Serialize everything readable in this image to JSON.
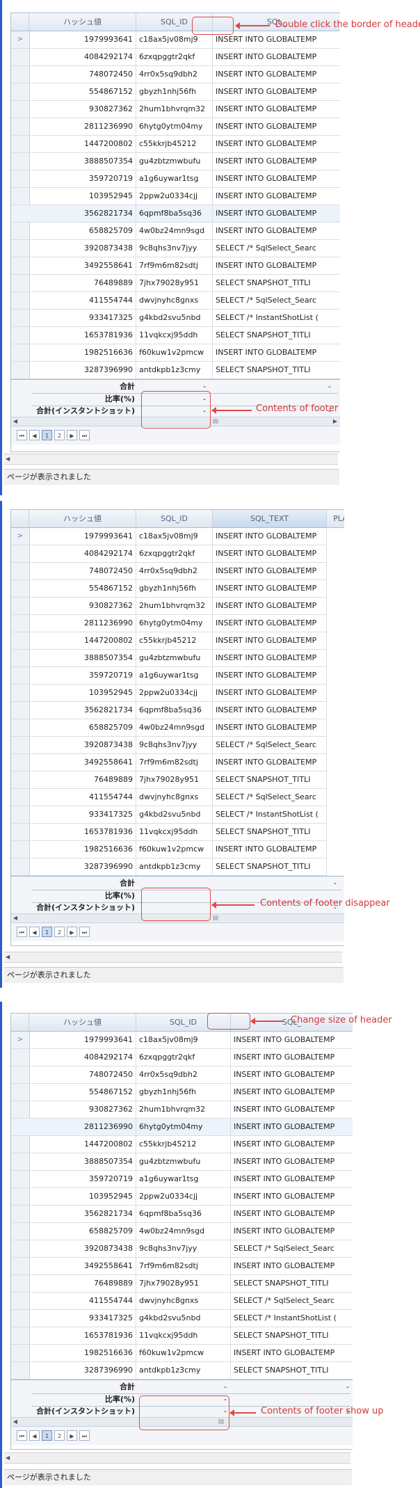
{
  "columns": {
    "hash": "ハッシュ値",
    "sql_id": "SQL_ID",
    "sql_text": "SQL_TEXT",
    "sql_text_clipped": "SQL_",
    "plan_clipped": "PLA"
  },
  "rows": [
    {
      "hash": "1979993641",
      "sql_id": "c18ax5jv08mj9",
      "sql_text": "INSERT INTO GLOBALTEMP"
    },
    {
      "hash": "4084292174",
      "sql_id": "6zxqpggtr2qkf",
      "sql_text": "INSERT INTO GLOBALTEMP"
    },
    {
      "hash": "748072450",
      "sql_id": "4rr0x5sq9dbh2",
      "sql_text": "INSERT INTO GLOBALTEMP"
    },
    {
      "hash": "554867152",
      "sql_id": "gbyzh1nhj56fh",
      "sql_text": "INSERT INTO GLOBALTEMP"
    },
    {
      "hash": "930827362",
      "sql_id": "2hum1bhvrqm32",
      "sql_text": "INSERT INTO GLOBALTEMP"
    },
    {
      "hash": "2811236990",
      "sql_id": "6hytg0ytm04my",
      "sql_text": "INSERT INTO GLOBALTEMP"
    },
    {
      "hash": "1447200802",
      "sql_id": "c55kkrjb45212",
      "sql_text": "INSERT INTO GLOBALTEMP"
    },
    {
      "hash": "3888507354",
      "sql_id": "gu4zbtzmwbufu",
      "sql_text": "INSERT INTO GLOBALTEMP"
    },
    {
      "hash": "359720719",
      "sql_id": "a1g6uywar1tsg",
      "sql_text": "INSERT INTO GLOBALTEMP"
    },
    {
      "hash": "103952945",
      "sql_id": "2ppw2u0334cjj",
      "sql_text": "INSERT INTO GLOBALTEMP"
    },
    {
      "hash": "3562821734",
      "sql_id": "6qpmf8ba5sq36",
      "sql_text": "INSERT INTO GLOBALTEMP"
    },
    {
      "hash": "658825709",
      "sql_id": "4w0bz24mn9sgd",
      "sql_text": "INSERT INTO GLOBALTEMP"
    },
    {
      "hash": "3920873438",
      "sql_id": "9c8qhs3nv7jyy",
      "sql_text": "SELECT /* SqlSelect_Searc"
    },
    {
      "hash": "3492558641",
      "sql_id": "7rf9m6m82sdtj",
      "sql_text": "INSERT INTO GLOBALTEMP"
    },
    {
      "hash": "76489889",
      "sql_id": "7jhx79028y951",
      "sql_text": "  SELECT   SNAPSHOT_TITLI"
    },
    {
      "hash": "411554744",
      "sql_id": "dwvjnyhc8gnxs",
      "sql_text": "SELECT /* SqlSelect_Searc"
    },
    {
      "hash": "933417325",
      "sql_id": "g4kbd2svu5nbd",
      "sql_text": "SELECT /* InstantShotList ("
    },
    {
      "hash": "1653781936",
      "sql_id": "11vqkcxj95ddh",
      "sql_text": "  SELECT   SNAPSHOT_TITLI"
    },
    {
      "hash": "1982516636",
      "sql_id": "f60kuw1v2pmcw",
      "sql_text": "INSERT INTO GLOBALTEMP"
    },
    {
      "hash": "3287396990",
      "sql_id": "antdkpb1z3cmy",
      "sql_text": "  SELECT   SNAPSHOT_TITLI"
    }
  ],
  "footer": {
    "total_label": "合計",
    "ratio_label": "比率(%)",
    "instant_label": "合計(インスタントショット)",
    "value": "-"
  },
  "pager": {
    "page1": "1",
    "page2": "2"
  },
  "status_text": "ページが表示されました",
  "annotations": {
    "a1": "Double click the border of header",
    "a2": "Contents of footer",
    "a3": "Contents of footer disappear",
    "a4": "Change size of header",
    "a5": "Contents of footer show up"
  },
  "colors": {
    "accent": "#e04848",
    "frame": "#2a5ad0"
  }
}
